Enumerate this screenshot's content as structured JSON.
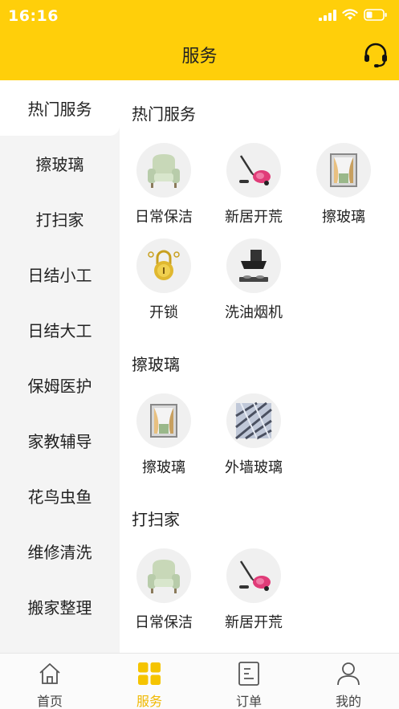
{
  "status_bar": {
    "time": "16:16"
  },
  "header": {
    "title": "服务"
  },
  "sidebar": {
    "items": [
      {
        "label": "热门服务",
        "active": true
      },
      {
        "label": "擦玻璃"
      },
      {
        "label": "打扫家"
      },
      {
        "label": "日结小工"
      },
      {
        "label": "日结大工"
      },
      {
        "label": "保姆医护"
      },
      {
        "label": "家教辅导"
      },
      {
        "label": "花鸟虫鱼"
      },
      {
        "label": "维修清洗"
      },
      {
        "label": "搬家整理"
      }
    ]
  },
  "sections": [
    {
      "title": "热门服务",
      "services": [
        {
          "label": "日常保洁",
          "icon": "armchair-icon"
        },
        {
          "label": "新居开荒",
          "icon": "vacuum-cleaner-icon"
        },
        {
          "label": "擦玻璃",
          "icon": "window-icon"
        },
        {
          "label": "开锁",
          "icon": "padlock-icon"
        },
        {
          "label": "洗油烟机",
          "icon": "range-hood-icon"
        }
      ]
    },
    {
      "title": "擦玻璃",
      "services": [
        {
          "label": "擦玻璃",
          "icon": "window-icon"
        },
        {
          "label": "外墙玻璃",
          "icon": "glass-wall-icon"
        }
      ]
    },
    {
      "title": "打扫家",
      "services": [
        {
          "label": "日常保洁",
          "icon": "armchair-icon"
        },
        {
          "label": "新居开荒",
          "icon": "vacuum-cleaner-icon"
        }
      ]
    }
  ],
  "tabbar": {
    "items": [
      {
        "label": "首页",
        "icon": "home-icon"
      },
      {
        "label": "服务",
        "icon": "grid-icon",
        "active": true
      },
      {
        "label": "订单",
        "icon": "order-icon"
      },
      {
        "label": "我的",
        "icon": "user-icon"
      }
    ]
  },
  "colors": {
    "brand": "#FFCF0A",
    "active_tab": "#F0B800",
    "sidebar_bg": "#F4F4F4"
  }
}
